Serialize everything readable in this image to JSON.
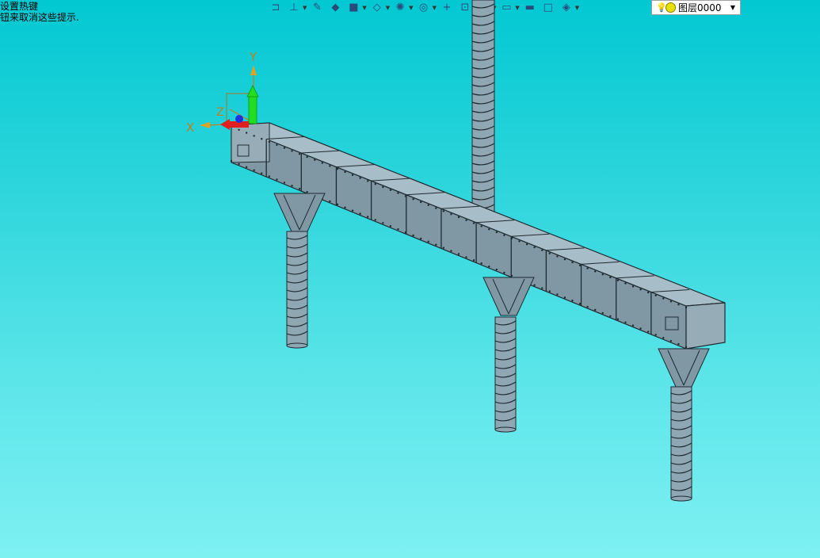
{
  "hint": {
    "line1": "设置热键",
    "line2": "钮来取消这些提示."
  },
  "toolbar": {
    "items": [
      {
        "icon": "exit-sketch-icon",
        "glyph": "⊐"
      },
      {
        "icon": "coordinate-system-icon",
        "glyph": "⊥"
      },
      {
        "icon": "pencil-icon",
        "glyph": "✎"
      },
      {
        "icon": "eraser-icon",
        "glyph": "◆"
      },
      {
        "icon": "box-view-icon",
        "glyph": "■"
      },
      {
        "icon": "cube-view-icon",
        "glyph": "◇"
      },
      {
        "icon": "render-mode-icon",
        "glyph": "✺"
      },
      {
        "icon": "zoom-icon",
        "glyph": "◎"
      },
      {
        "icon": "crosshair-icon",
        "glyph": "+"
      },
      {
        "icon": "fit-view-icon",
        "glyph": "⊡"
      },
      {
        "icon": "section-view-icon",
        "glyph": "⊓"
      },
      {
        "icon": "display-icon",
        "glyph": "▭"
      },
      {
        "icon": "line-color-icon",
        "glyph": "▬"
      },
      {
        "icon": "fill-color-icon",
        "glyph": "□"
      },
      {
        "icon": "layer-manager-icon",
        "glyph": "◈"
      }
    ]
  },
  "layer": {
    "name": "图层0000"
  },
  "axes": {
    "x_label": "X",
    "y_label": "Y",
    "z_label": "Z"
  },
  "colors": {
    "background_top": "#02c8d2",
    "background_bottom": "#7ef0f2",
    "model_fill": "#8fa7b3",
    "model_stroke": "#1e2a30",
    "axis_x": "#e02020",
    "axis_y": "#20d020",
    "axis_z": "#2030e0",
    "axis_label": "#c08020"
  }
}
